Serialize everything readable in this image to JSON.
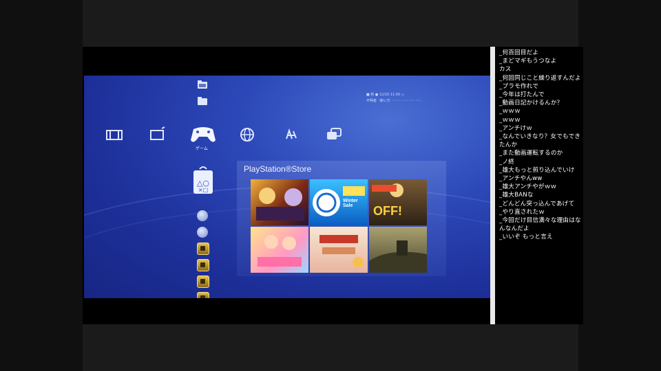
{
  "layout": {
    "bg_color": "#000000",
    "pillar_color": "#101010",
    "letterbox_color": "#1b1b1b"
  },
  "xmb": {
    "accent_color": "#1d2f99",
    "status_lines": [
      "■ 新  ●   12/20 11:00  ◇",
      "不明者 ◦使い方 ◦◦◦◦◦ ◦◦◦◦◦◦ ◦◦◦"
    ],
    "categories": [
      {
        "icon": "video-icon",
        "label": ""
      },
      {
        "icon": "tv-icon",
        "label": ""
      },
      {
        "icon": "gamepad-icon",
        "label": "ゲーム"
      },
      {
        "icon": "network-icon",
        "label": ""
      },
      {
        "icon": "playstation-network-icon",
        "label": ""
      },
      {
        "icon": "friends-icon",
        "label": ""
      }
    ],
    "selected_category_label": "ゲーム",
    "store": {
      "title": "PlayStation®Store",
      "tiles": [
        {
          "icon": "promo-banner-1",
          "caption": "",
          "color": "#d98a20"
        },
        {
          "icon": "promo-banner-2",
          "caption": "Winter Sale",
          "color": "#36a6e0"
        },
        {
          "icon": "promo-banner-3",
          "caption": "OFF!",
          "color": "#c97922"
        },
        {
          "icon": "promo-banner-4",
          "caption": "",
          "color": "#f2c24a"
        },
        {
          "icon": "promo-banner-5",
          "caption": "",
          "color": "#f3dcc6"
        },
        {
          "icon": "promo-banner-6",
          "caption": "",
          "color": "#8a8254"
        }
      ]
    }
  },
  "comments": [
    "_何百回目だよ",
    "_まどマギもうつなよ",
    "カス",
    "_何回同じこと繰り返すんだよ",
    "_プラモ作れで",
    "_今年は打たんで",
    "_動画日記かけるんか？",
    "_ｗｗｗ",
    "_ｗｗｗ",
    "_アンチけｗ",
    "_なんでいきなり？女でもできたんか",
    "_また動画運転するのか",
    "_ノ終",
    "_雄大もっと煎り込んでいけ",
    "_アンチやんww",
    "_雄大アンチやがｗｗ",
    "_雄大BANな",
    "_どんどん突っ込んであげて",
    "_やり直されたｗ",
    "_今回だけ目信満々な理由はなんなんだよ",
    "_いいぞ もっと言え"
  ]
}
